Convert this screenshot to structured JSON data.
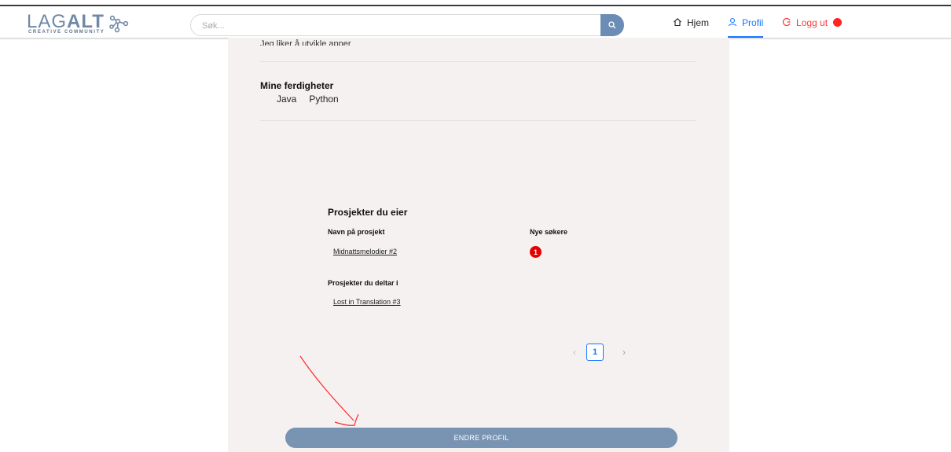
{
  "header": {
    "logo_main_light": "LAG",
    "logo_main_bold": "ALT",
    "logo_sub": "CREATIVE COMMUNITY",
    "search_placeholder": "Søk...",
    "nav": {
      "home": "Hjem",
      "profile": "Profil",
      "logout": "Logg ut"
    }
  },
  "profile": {
    "about_text": "Jeg liker å utvikle apper",
    "skills_title": "Mine ferdigheter",
    "skills": [
      "Java",
      "Python"
    ]
  },
  "projects": {
    "owned_title": "Prosjekter du eier",
    "col_name": "Navn på prosjekt",
    "col_new": "Nye søkere",
    "owned": [
      {
        "name": "Midnattsmelodier #2",
        "new_applicants": "1"
      }
    ],
    "participating_title": "Prosjekter du deltar i",
    "participating": [
      {
        "name": "Lost in Translation #3"
      }
    ]
  },
  "pagination": {
    "prev": "‹",
    "current": "1",
    "next": "›"
  },
  "actions": {
    "edit_profile": "ENDRE PROFIL"
  },
  "colors": {
    "accent": "#1677ff",
    "logout": "#ff3b3b",
    "button": "#7894b2",
    "badge": "#e60000",
    "panel": "#f5f1f1"
  },
  "icons": {
    "search": "search-icon",
    "home": "home-icon",
    "profile": "user-icon",
    "logout": "logout-icon",
    "annotation": "red-arrow"
  }
}
